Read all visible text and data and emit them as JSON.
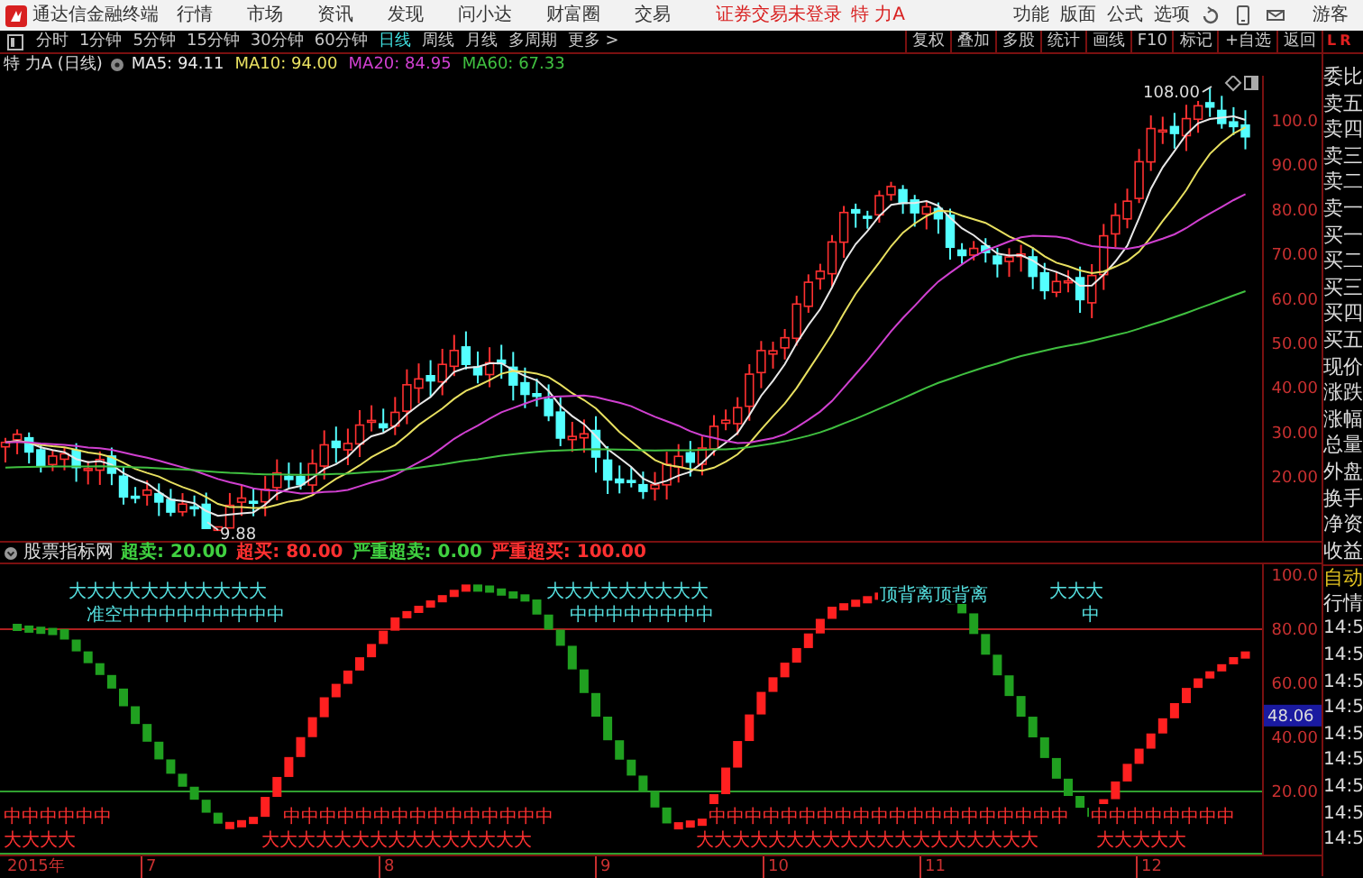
{
  "app": {
    "title": "通达信金融终端",
    "menus": [
      "行情",
      "市场",
      "资讯",
      "发现",
      "问小达",
      "财富圈",
      "交易"
    ],
    "login_status": "证券交易未登录",
    "stock_name": "特 力A",
    "tools": [
      "功能",
      "版面",
      "公式",
      "选项"
    ],
    "user": "游客"
  },
  "period_bar": {
    "periods": [
      {
        "label": "分时",
        "selected": false
      },
      {
        "label": "1分钟",
        "selected": false
      },
      {
        "label": "5分钟",
        "selected": false
      },
      {
        "label": "15分钟",
        "selected": false
      },
      {
        "label": "30分钟",
        "selected": false
      },
      {
        "label": "60分钟",
        "selected": false
      },
      {
        "label": "日线",
        "selected": true
      },
      {
        "label": "周线",
        "selected": false
      },
      {
        "label": "月线",
        "selected": false
      },
      {
        "label": "多周期",
        "selected": false
      },
      {
        "label": "更多 >",
        "selected": false
      }
    ],
    "actions": [
      "复权",
      "叠加",
      "多股",
      "统计",
      "画线",
      "F10",
      "标记",
      "+自选",
      "返回"
    ]
  },
  "main_chart": {
    "title": "特 力A (日线)",
    "averages": [
      {
        "label": "MA5: 94.11",
        "color": "#e8e8e8"
      },
      {
        "label": "MA10: 94.00",
        "color": "#e8e060"
      },
      {
        "label": "MA20: 84.95",
        "color": "#d040d0"
      },
      {
        "label": "MA60: 67.33",
        "color": "#40c040"
      }
    ],
    "y_labels": [
      "100.0",
      "90.00",
      "80.00",
      "70.00",
      "60.00",
      "50.00",
      "40.00",
      "30.00",
      "20.00"
    ],
    "high_label": "108.00",
    "low_label": "9.88"
  },
  "indicator": {
    "title": "股票指标网",
    "params": [
      {
        "label": "超卖:",
        "value": "20.00",
        "color": "#40d040"
      },
      {
        "label": "超买:",
        "value": "80.00",
        "color": "#ff3030"
      },
      {
        "label": "严重超卖:",
        "value": "0.00",
        "color": "#40d040"
      },
      {
        "label": "严重超买:",
        "value": "100.00",
        "color": "#ff3030"
      }
    ],
    "y_labels": [
      "100.0",
      "80.00",
      "60.00",
      "40.00",
      "20.00"
    ],
    "current": "48.06",
    "signals": [
      {
        "text": "大大大大大大大大大大大",
        "color": "#55e0e0"
      },
      {
        "text": "准空中中中中中中中中中",
        "color": "#55e0e0"
      },
      {
        "text": "大大大大大大大大大",
        "color": "#55e0e0"
      },
      {
        "text": "中中中中中中中中",
        "color": "#55e0e0"
      },
      {
        "text": "顶背离顶背离",
        "color": "#55e0e0"
      },
      {
        "text": "大大大",
        "color": "#55e0e0"
      },
      {
        "text": "中",
        "color": "#55e0e0"
      },
      {
        "text": "中中中中中中",
        "color": "#ff3030"
      },
      {
        "text": "大大大大",
        "color": "#ff3030"
      },
      {
        "text": "中中中中中中中中中中中中中中中",
        "color": "#ff3030"
      },
      {
        "text": "大大大大大大大大大大大大大大大",
        "color": "#ff3030"
      },
      {
        "text": "中中中中中中中中中中中中中中中中中中中中",
        "color": "#ff3030"
      },
      {
        "text": "大大大大大大大大大大大大大大大大大大大",
        "color": "#ff3030"
      },
      {
        "text": "中中中中中中中中",
        "color": "#ff3030"
      },
      {
        "text": "大大大大大",
        "color": "#ff3030"
      }
    ]
  },
  "x_axis": [
    "2015年",
    "7",
    "8",
    "9",
    "10",
    "11",
    "12"
  ],
  "right_panel": {
    "header": [
      "L",
      "R"
    ],
    "labels": [
      "委比",
      "卖五",
      "卖四",
      "卖三",
      "卖二",
      "卖一",
      "买一",
      "买二",
      "买三",
      "买四",
      "买五",
      "现价",
      "涨跌",
      "涨幅",
      "总量",
      "外盘",
      "换手",
      "净资",
      "收益"
    ],
    "modes": [
      "自动",
      "行情"
    ],
    "times": [
      "14:5",
      "14:5",
      "14:5",
      "14:5",
      "14:5",
      "14:5",
      "14:5",
      "14:5",
      "14:5"
    ]
  }
}
